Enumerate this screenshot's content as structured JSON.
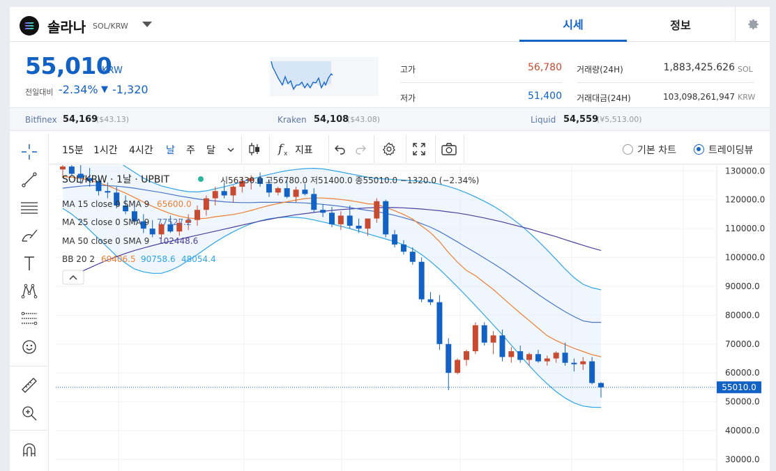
{
  "header": {
    "coin_name": "솔라나",
    "pair": "SOL/KRW",
    "tabs": [
      {
        "label": "시세",
        "active": true
      },
      {
        "label": "정보",
        "active": false
      }
    ]
  },
  "summary": {
    "price": "55,010",
    "price_unit": "KRW",
    "change_label": "전일대비",
    "change_rate": "-2.34%",
    "change_arrow": "▼",
    "change_amount": "-1,320",
    "high_label": "고가",
    "high_value": "56,780",
    "low_label": "저가",
    "low_value": "51,400",
    "volume_label": "거래량(24H)",
    "volume_value": "1,883,425.626",
    "volume_unit": "SOL",
    "amount_label": "거래대금(24H)",
    "amount_value": "103,098,261,947",
    "amount_unit": "KRW"
  },
  "exchanges": [
    {
      "name": "Bitfinex",
      "price": "54,169",
      "sub": "($43.13)"
    },
    {
      "name": "Kraken",
      "price": "54,108",
      "sub": "($43.08)"
    },
    {
      "name": "Liquid",
      "price": "54,559",
      "sub": "(¥5,513.00)"
    }
  ],
  "toolbar": {
    "intervals": [
      "15분",
      "1시간",
      "4시간",
      "날",
      "주",
      "달"
    ],
    "active_interval": "날",
    "indicator_label": "지표",
    "chart_modes": [
      {
        "label": "기본 차트",
        "selected": false
      },
      {
        "label": "트레이딩뷰",
        "selected": true
      }
    ]
  },
  "colors": {
    "accent": "#1261c4",
    "up": "#c84a31",
    "down": "#1261c4",
    "ma15": "#ef7f32",
    "ma25": "#4a74c9",
    "ma50": "#4b3f9e",
    "bb": "#2fa4e7"
  },
  "overlay": {
    "title": "SOL/KRW · 1날 · UPBIT",
    "ohlc_text": "시56330.0 고56780.0 저51400.0 종55010.0 −1320.0 (−2.34%)",
    "legends": [
      {
        "label": "MA 15 close 0 SMA 9",
        "value": "65600.0",
        "color": "#ef7f32"
      },
      {
        "label": "MA 25 close 0 SMA 9",
        "value": "77527.2",
        "color": "#4a74c9"
      },
      {
        "label": "MA 50 close 0 SMA 9",
        "value": "102448.6",
        "color": "#4b3f9e"
      }
    ],
    "bb_label": "BB 20 2",
    "bb_values": [
      {
        "value": "69406.5",
        "color": "#ef7f32"
      },
      {
        "value": "90758.6",
        "color": "#2fa4e7"
      },
      {
        "value": "48054.4",
        "color": "#2fa4e7"
      }
    ]
  },
  "chart_data": {
    "type": "candlestick",
    "yaxis_ticks": [
      "130000.0",
      "120000.0",
      "110000.0",
      "100000.0",
      "90000.0",
      "80000.0",
      "70000.0",
      "60000.0",
      "50000.0",
      "40000.0",
      "30000.0"
    ],
    "ylim": [
      26000,
      132000
    ],
    "current_price_label": "55010.0",
    "current_price": 55010,
    "candles": [
      {
        "o": 130500,
        "h": 133500,
        "l": 127500,
        "c": 131500
      },
      {
        "o": 131500,
        "h": 134000,
        "l": 128500,
        "c": 129000
      },
      {
        "o": 129000,
        "h": 132000,
        "l": 125500,
        "c": 127500
      },
      {
        "o": 127500,
        "h": 131000,
        "l": 124500,
        "c": 126500
      },
      {
        "o": 126500,
        "h": 128500,
        "l": 121500,
        "c": 123000
      },
      {
        "o": 123000,
        "h": 126000,
        "l": 120500,
        "c": 122500
      },
      {
        "o": 122500,
        "h": 124500,
        "l": 117000,
        "c": 118000
      },
      {
        "o": 118000,
        "h": 121500,
        "l": 115000,
        "c": 116000
      },
      {
        "o": 116000,
        "h": 119500,
        "l": 111500,
        "c": 112500
      },
      {
        "o": 112500,
        "h": 115000,
        "l": 108500,
        "c": 110000
      },
      {
        "o": 110000,
        "h": 113000,
        "l": 107000,
        "c": 108000
      },
      {
        "o": 108000,
        "h": 112000,
        "l": 106500,
        "c": 111500
      },
      {
        "o": 111500,
        "h": 114500,
        "l": 108500,
        "c": 109000
      },
      {
        "o": 109000,
        "h": 113500,
        "l": 107500,
        "c": 112000
      },
      {
        "o": 112000,
        "h": 115000,
        "l": 109500,
        "c": 113000
      },
      {
        "o": 113000,
        "h": 118000,
        "l": 111000,
        "c": 116500
      },
      {
        "o": 116500,
        "h": 121500,
        "l": 114500,
        "c": 120500
      },
      {
        "o": 120500,
        "h": 124500,
        "l": 118000,
        "c": 123000
      },
      {
        "o": 123000,
        "h": 126000,
        "l": 120500,
        "c": 121500
      },
      {
        "o": 121500,
        "h": 125000,
        "l": 119000,
        "c": 124500
      },
      {
        "o": 124500,
        "h": 128000,
        "l": 122500,
        "c": 126500
      },
      {
        "o": 126500,
        "h": 128500,
        "l": 123500,
        "c": 127500
      },
      {
        "o": 127500,
        "h": 129500,
        "l": 124500,
        "c": 125500
      },
      {
        "o": 125500,
        "h": 127000,
        "l": 121000,
        "c": 122500
      },
      {
        "o": 122500,
        "h": 124500,
        "l": 121500,
        "c": 124000
      },
      {
        "o": 124000,
        "h": 126500,
        "l": 120500,
        "c": 121000
      },
      {
        "o": 121000,
        "h": 124500,
        "l": 119000,
        "c": 123500
      },
      {
        "o": 123500,
        "h": 125500,
        "l": 121500,
        "c": 122000
      },
      {
        "o": 122000,
        "h": 124000,
        "l": 115500,
        "c": 116500
      },
      {
        "o": 116500,
        "h": 118500,
        "l": 114000,
        "c": 115500
      },
      {
        "o": 115500,
        "h": 117500,
        "l": 110500,
        "c": 111500
      },
      {
        "o": 111500,
        "h": 116000,
        "l": 109500,
        "c": 114500
      },
      {
        "o": 114500,
        "h": 118000,
        "l": 110000,
        "c": 111000
      },
      {
        "o": 111000,
        "h": 113500,
        "l": 108500,
        "c": 110000
      },
      {
        "o": 110000,
        "h": 112000,
        "l": 107500,
        "c": 113500
      },
      {
        "o": 113500,
        "h": 120500,
        "l": 112000,
        "c": 119500
      },
      {
        "o": 119500,
        "h": 120000,
        "l": 107000,
        "c": 108000
      },
      {
        "o": 108000,
        "h": 109500,
        "l": 103500,
        "c": 104500
      },
      {
        "o": 104500,
        "h": 106000,
        "l": 101000,
        "c": 102000
      },
      {
        "o": 102000,
        "h": 103500,
        "l": 97500,
        "c": 98500
      },
      {
        "o": 98500,
        "h": 100000,
        "l": 84500,
        "c": 85500
      },
      {
        "o": 85500,
        "h": 88000,
        "l": 83500,
        "c": 84500
      },
      {
        "o": 84500,
        "h": 87000,
        "l": 68000,
        "c": 70000
      },
      {
        "o": 70000,
        "h": 72000,
        "l": 54000,
        "c": 60000
      },
      {
        "o": 60000,
        "h": 65000,
        "l": 59500,
        "c": 64500
      },
      {
        "o": 64500,
        "h": 68000,
        "l": 62500,
        "c": 67500
      },
      {
        "o": 67500,
        "h": 77500,
        "l": 66500,
        "c": 76500
      },
      {
        "o": 76500,
        "h": 77500,
        "l": 69500,
        "c": 70500
      },
      {
        "o": 70500,
        "h": 74500,
        "l": 66500,
        "c": 73000
      },
      {
        "o": 73000,
        "h": 75000,
        "l": 64000,
        "c": 65500
      },
      {
        "o": 65500,
        "h": 69000,
        "l": 63500,
        "c": 67500
      },
      {
        "o": 67500,
        "h": 69500,
        "l": 63500,
        "c": 64500
      },
      {
        "o": 64500,
        "h": 67000,
        "l": 62500,
        "c": 66500
      },
      {
        "o": 66500,
        "h": 68000,
        "l": 63500,
        "c": 64000
      },
      {
        "o": 64000,
        "h": 66000,
        "l": 62500,
        "c": 65000
      },
      {
        "o": 65000,
        "h": 67500,
        "l": 63500,
        "c": 67000
      },
      {
        "o": 67000,
        "h": 70500,
        "l": 62500,
        "c": 63500
      },
      {
        "o": 63500,
        "h": 65000,
        "l": 60500,
        "c": 63000
      },
      {
        "o": 63000,
        "h": 65500,
        "l": 61000,
        "c": 64000
      },
      {
        "o": 64000,
        "h": 65500,
        "l": 56000,
        "c": 56500
      },
      {
        "o": 56500,
        "h": 56800,
        "l": 51400,
        "c": 55010
      }
    ],
    "ma15": [
      128000,
      127800,
      127400,
      126800,
      125900,
      124900,
      123600,
      122300,
      120800,
      119200,
      117700,
      116400,
      115200,
      114300,
      113700,
      113400,
      113600,
      114100,
      114500,
      114900,
      115500,
      116300,
      117200,
      118000,
      118700,
      119300,
      119900,
      120400,
      120600,
      120600,
      120400,
      120100,
      119700,
      119200,
      118600,
      118400,
      117400,
      116200,
      114900,
      113300,
      110900,
      108600,
      105500,
      101700,
      98400,
      95500,
      93700,
      91300,
      88900,
      86100,
      83400,
      80700,
      78100,
      75500,
      72900,
      71200,
      69800,
      68500,
      67400,
      66300,
      65600
    ],
    "ma25": [
      124000,
      124400,
      124700,
      124900,
      125000,
      124900,
      124700,
      124400,
      124000,
      123500,
      123000,
      122500,
      121900,
      121300,
      120800,
      120300,
      119900,
      119600,
      119300,
      119100,
      119000,
      119000,
      119100,
      119100,
      119100,
      119100,
      119000,
      118900,
      118700,
      118400,
      118100,
      117700,
      117300,
      116800,
      116300,
      115900,
      115300,
      114600,
      113800,
      112900,
      111700,
      110500,
      109000,
      107200,
      105400,
      103500,
      101700,
      99800,
      97900,
      95900,
      93800,
      91600,
      89400,
      87200,
      85100,
      83100,
      81200,
      79500,
      78000,
      77527,
      77527
    ],
    "ma50": [
      92000,
      93500,
      95000,
      96400,
      97800,
      99100,
      100300,
      101400,
      102400,
      103300,
      104100,
      104900,
      105600,
      106300,
      107000,
      107700,
      108400,
      109100,
      109800,
      110500,
      111200,
      111900,
      112600,
      113200,
      113800,
      114300,
      114800,
      115200,
      115600,
      116000,
      116300,
      116600,
      116800,
      117000,
      117200,
      117300,
      117300,
      117300,
      117200,
      117000,
      116800,
      116500,
      116200,
      115800,
      115400,
      114900,
      114300,
      113700,
      113000,
      112300,
      111500,
      110700,
      109900,
      109000,
      108100,
      107200,
      106200,
      105200,
      104200,
      103300,
      102448
    ],
    "bb_upper": [
      142000,
      141500,
      140500,
      139000,
      137500,
      135500,
      133500,
      131500,
      129500,
      127500,
      126000,
      124800,
      124000,
      123300,
      122800,
      122700,
      123100,
      123800,
      124500,
      125300,
      126200,
      127100,
      128000,
      128800,
      129500,
      130100,
      130500,
      130800,
      130900,
      130700,
      130200,
      129600,
      129000,
      128400,
      127800,
      127400,
      127200,
      127000,
      126800,
      126600,
      126400,
      126000,
      125400,
      124600,
      123600,
      122400,
      121000,
      119500,
      117800,
      115900,
      113700,
      111300,
      108600,
      105700,
      102600,
      99300,
      96000,
      93000,
      90700,
      89500,
      88800
    ],
    "bb_lower": [
      117000,
      115000,
      112500,
      109500,
      106500,
      103500,
      100500,
      98000,
      96000,
      95000,
      94500,
      94500,
      95500,
      97000,
      99000,
      101000,
      103200,
      105300,
      107200,
      108900,
      110400,
      111700,
      112700,
      113400,
      113800,
      114000,
      113900,
      113600,
      113000,
      112300,
      111600,
      110800,
      110000,
      109100,
      108200,
      107300,
      106400,
      105500,
      104400,
      103000,
      101000,
      98600,
      95900,
      92900,
      89800,
      86600,
      83300,
      80000,
      76600,
      73200,
      69600,
      66000,
      62500,
      59200,
      56200,
      53500,
      51300,
      49600,
      48500,
      48100,
      48054
    ]
  }
}
